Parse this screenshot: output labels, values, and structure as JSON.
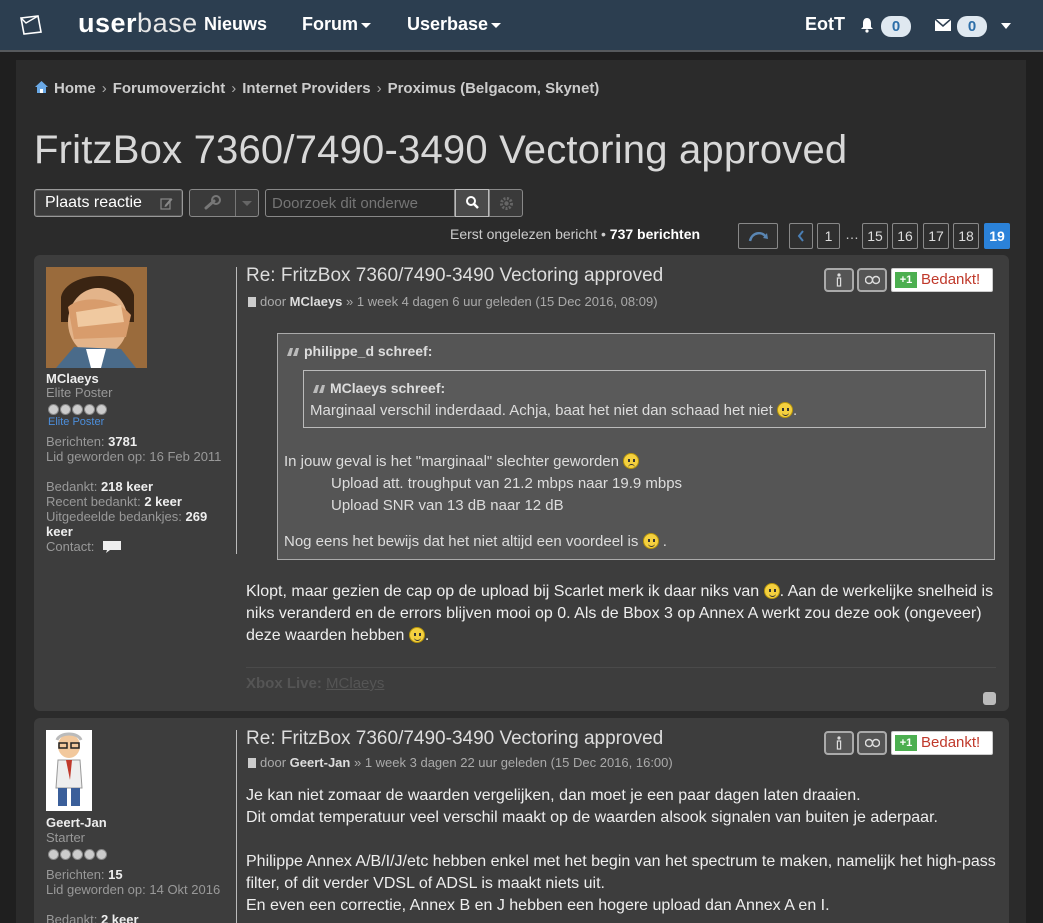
{
  "header": {
    "logo_bold": "user",
    "logo_rest": "base",
    "nav": [
      "Nieuws",
      "Forum",
      "Userbase"
    ],
    "username": "EotT",
    "notifications_count": "0",
    "messages_count": "0"
  },
  "breadcrumb": [
    "Home",
    "Forumoverzicht",
    "Internet Providers",
    "Proximus (Belgacom, Skynet)"
  ],
  "topic": {
    "title": "FritzBox 7360/7490-3490 Vectoring approved",
    "reply_button": "Plaats reactie",
    "search_placeholder": "Doorzoek dit onderwe"
  },
  "pagination": {
    "first_unread": "Eerst ongelezen bericht",
    "bullet": "•",
    "count": "737 berichten",
    "pages": [
      "1",
      "…",
      "15",
      "16",
      "17",
      "18",
      "19"
    ],
    "active": "19"
  },
  "posts": [
    {
      "author": "MClaeys",
      "rank": "Elite Poster",
      "rank_label": "Elite Poster",
      "info": {
        "berichten_label": "Berichten:",
        "berichten": "3781",
        "lid_label": "Lid geworden op:",
        "lid": "16 Feb 2011",
        "bedankt_label": "Bedankt:",
        "bedankt": "218 keer",
        "recent_label": "Recent bedankt:",
        "recent": "2 keer",
        "uitgedeeld_label": "Uitgedeelde bedankjes:",
        "uitgedeeld": "269 keer",
        "contact_label": "Contact:"
      },
      "title": "Re: FritzBox 7360/7490-3490 Vectoring approved",
      "meta_by": "door",
      "meta_author": "MClaeys",
      "meta_rest": "» 1 week 4 dagen 6 uur geleden (15 Dec 2016, 08:09)",
      "thanks_plus": "+1",
      "thanks_label": "Bedankt!",
      "quote": {
        "author": "philippe_d schreef:",
        "inner_author": "MClaeys schreef:",
        "inner_text": "Marginaal verschil inderdaad. Achja, baat het niet dan schaad het niet",
        "line1": "In jouw geval is het \"marginaal\" slechter geworden",
        "line2": "Upload att. troughput van 21.2 mbps naar 19.9 mbps",
        "line3": "Upload SNR van 13 dB naar 12 dB",
        "line4": "Nog eens het bewijs dat het niet altijd een voordeel is",
        "line4_end": "."
      },
      "body_1": "Klopt, maar gezien de cap op de upload bij Scarlet merk ik daar niks van",
      "body_2": ". Aan de werkelijke snelheid is niks veranderd en de errors blijven mooi op 0. Als de Bbox 3 op Annex A werkt zou deze ook (ongeveer) deze waarden hebben",
      "sig_label": "Xbox Live:",
      "sig_value": "MClaeys"
    },
    {
      "author": "Geert-Jan",
      "rank": "Starter",
      "info": {
        "berichten_label": "Berichten:",
        "berichten": "15",
        "lid_label": "Lid geworden op:",
        "lid": "14 Okt 2016",
        "bedankt_label": "Bedankt:",
        "bedankt": "2 keer"
      },
      "title": "Re: FritzBox 7360/7490-3490 Vectoring approved",
      "meta_by": "door",
      "meta_author": "Geert-Jan",
      "meta_rest": "» 1 week 3 dagen 22 uur geleden (15 Dec 2016, 16:00)",
      "thanks_plus": "+1",
      "thanks_label": "Bedankt!",
      "body_l1": "Je kan niet zomaar de waarden vergelijken, dan moet je een paar dagen laten draaien.",
      "body_l2": "Dit omdat temperatuur veel verschil maakt op de waarden alsook signalen van buiten je aderpaar.",
      "body_l3": "Philippe Annex A/B/I/J/etc hebben enkel met het begin van het spectrum te maken, namelijk het high-pass filter, of dit verder VDSL of ADSL is maakt niets uit.",
      "body_l4": "En even een correctie, Annex B en J hebben een hogere upload dan Annex A en I."
    }
  ],
  "icons": {
    "logo": "userbase-logo-icon",
    "home": "home-icon",
    "bell": "bell-icon",
    "mail": "mail-icon",
    "search": "search-icon",
    "gear": "gear-icon",
    "wrench": "wrench-icon",
    "refresh": "refresh-arrow-icon",
    "quote": "quote-icon",
    "info": "info-icon",
    "report": "report-icon"
  },
  "colors": {
    "header_bg": "#2c3e50",
    "active_page": "#2b82d9",
    "thanks_text": "#c0392b",
    "thanks_plus": "#4caf50"
  }
}
